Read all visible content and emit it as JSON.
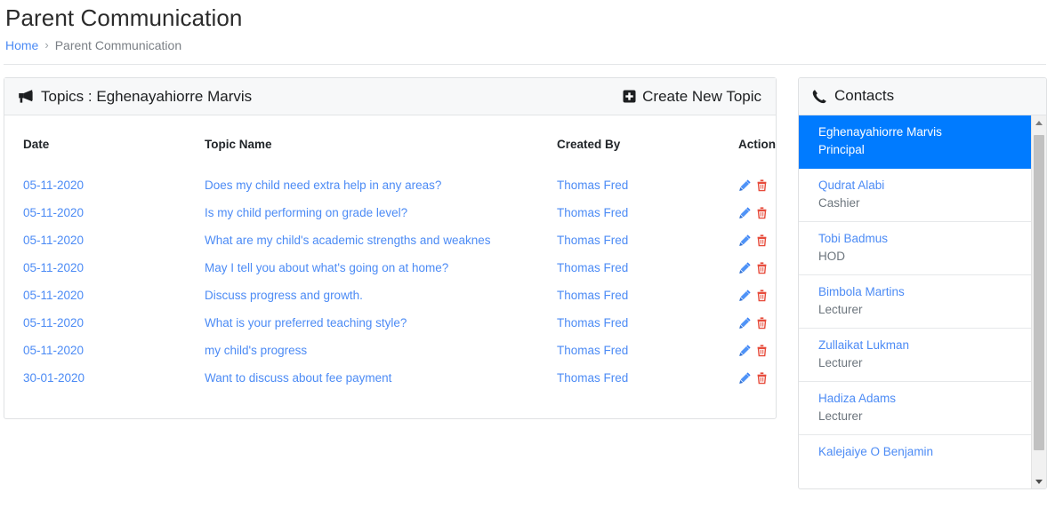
{
  "page": {
    "title": "Parent Communication"
  },
  "breadcrumb": {
    "home": "Home",
    "separator": "›",
    "current": "Parent Communication"
  },
  "topics_card": {
    "header_label": "Topics : Eghenayahiorre Marvis",
    "header_icon": "bullhorn-icon",
    "create_button": {
      "label": "Create New Topic",
      "icon": "plus-square-icon"
    },
    "columns": [
      "Date",
      "Topic Name",
      "Created By",
      "Action"
    ],
    "rows": [
      {
        "date": "05-11-2020",
        "topic": "Does my child need extra help in any areas?",
        "created_by": "Thomas Fred"
      },
      {
        "date": "05-11-2020",
        "topic": "Is my child performing on grade level?",
        "created_by": "Thomas Fred"
      },
      {
        "date": "05-11-2020",
        "topic": "What are my child's academic strengths and weaknes",
        "created_by": "Thomas Fred"
      },
      {
        "date": "05-11-2020",
        "topic": "May I tell you about what's going on at home?",
        "created_by": "Thomas Fred"
      },
      {
        "date": "05-11-2020",
        "topic": "Discuss progress and growth.",
        "created_by": "Thomas Fred"
      },
      {
        "date": "05-11-2020",
        "topic": "What is your preferred teaching style?",
        "created_by": "Thomas Fred"
      },
      {
        "date": "05-11-2020",
        "topic": "my child's progress",
        "created_by": "Thomas Fred"
      },
      {
        "date": "30-01-2020",
        "topic": "Want to discuss about fee payment",
        "created_by": "Thomas Fred"
      }
    ],
    "row_actions": {
      "edit_icon": "pencil-icon",
      "delete_icon": "trash-icon"
    }
  },
  "contacts_card": {
    "header_label": "Contacts",
    "header_icon": "phone-icon",
    "items": [
      {
        "name": "Eghenayahiorre Marvis",
        "role": "Principal",
        "active": true
      },
      {
        "name": "Qudrat Alabi",
        "role": "Cashier",
        "active": false
      },
      {
        "name": "Tobi Badmus",
        "role": "HOD",
        "active": false
      },
      {
        "name": "Bimbola Martins",
        "role": "Lecturer",
        "active": false
      },
      {
        "name": "Zullaikat Lukman",
        "role": "Lecturer",
        "active": false
      },
      {
        "name": "Hadiza Adams",
        "role": "Lecturer",
        "active": false
      },
      {
        "name": "Kalejaiye O Benjamin",
        "role": "",
        "active": false
      }
    ]
  },
  "colors": {
    "link": "#4c8bf5",
    "active_bg": "#007bff",
    "edit_icon": "#3b82f6",
    "delete_icon": "#e74c3c",
    "muted_text": "#6c757d",
    "card_header_bg": "#f7f8f9"
  }
}
